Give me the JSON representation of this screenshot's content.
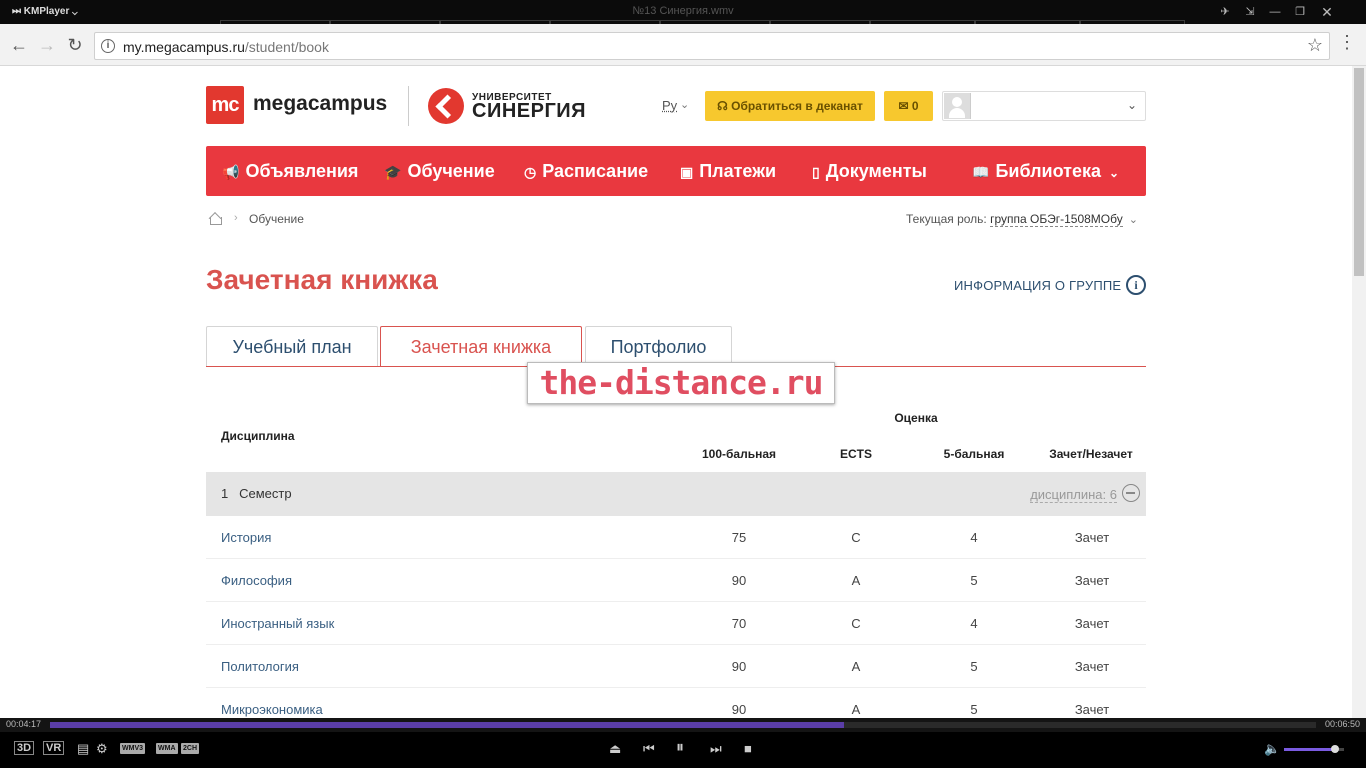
{
  "player": {
    "app_name": "KMPlayer",
    "file_title": "№13 Синергия.wmv",
    "time_elapsed": "00:04:17",
    "time_total": "00:06:50",
    "progress": 0.627,
    "volume": 0.85,
    "left_labels": [
      "3D",
      "VR"
    ],
    "format_tags": [
      "WMV3",
      "WMA",
      "2CH"
    ],
    "accent_color": "#5b3ea8"
  },
  "browser": {
    "url_host": "my.megacampus.ru",
    "url_path": "/student/book"
  },
  "header": {
    "logo_mark": "mc",
    "logo_name": "megacampus",
    "partner_small": "УНИВЕРСИТЕТ",
    "partner_big": "СИНЕРГИЯ",
    "language": "Ру",
    "dean_button": "Обратиться в деканат",
    "messages_count": "0",
    "brand_color": "#e2382f"
  },
  "nav": {
    "items": [
      {
        "label": "Объявления",
        "icon": "megaphone-icon"
      },
      {
        "label": "Обучение",
        "icon": "graduation-cap-icon"
      },
      {
        "label": "Расписание",
        "icon": "clock-icon"
      },
      {
        "label": "Платежи",
        "icon": "money-icon"
      },
      {
        "label": "Документы",
        "icon": "document-icon"
      },
      {
        "label": "Библиотека",
        "icon": "book-icon"
      }
    ]
  },
  "breadcrumb": {
    "current": "Обучение"
  },
  "role": {
    "label": "Текущая роль:",
    "value": "группа ОБЭг-1508МОбу"
  },
  "page": {
    "title": "Зачетная книжка",
    "group_info_link": "ИНФОРМАЦИЯ О ГРУППЕ",
    "tabs": [
      {
        "label": "Учебный план",
        "active": false
      },
      {
        "label": "Зачетная книжка",
        "active": true
      },
      {
        "label": "Портфолио",
        "active": false
      }
    ],
    "watermark": "the-distance.ru"
  },
  "table": {
    "col_discipline": "Дисциплина",
    "col_grade_group": "Оценка",
    "col_100": "100-бальная",
    "col_ects": "ECTS",
    "col_5": "5-бальная",
    "col_pass": "Зачет/Незачет",
    "semester_number": "1",
    "semester_label": "Семестр",
    "semester_count": "дисциплина: 6",
    "rows": [
      {
        "name": "История",
        "score": "75",
        "ects": "C",
        "five": "4",
        "pass": "Зачет"
      },
      {
        "name": "Философия",
        "score": "90",
        "ects": "A",
        "five": "5",
        "pass": "Зачет"
      },
      {
        "name": "Иностранный язык",
        "score": "70",
        "ects": "C",
        "five": "4",
        "pass": "Зачет"
      },
      {
        "name": "Политология",
        "score": "90",
        "ects": "A",
        "five": "5",
        "pass": "Зачет"
      },
      {
        "name": "Микроэкономика",
        "score": "90",
        "ects": "A",
        "five": "5",
        "pass": "Зачет"
      }
    ]
  }
}
